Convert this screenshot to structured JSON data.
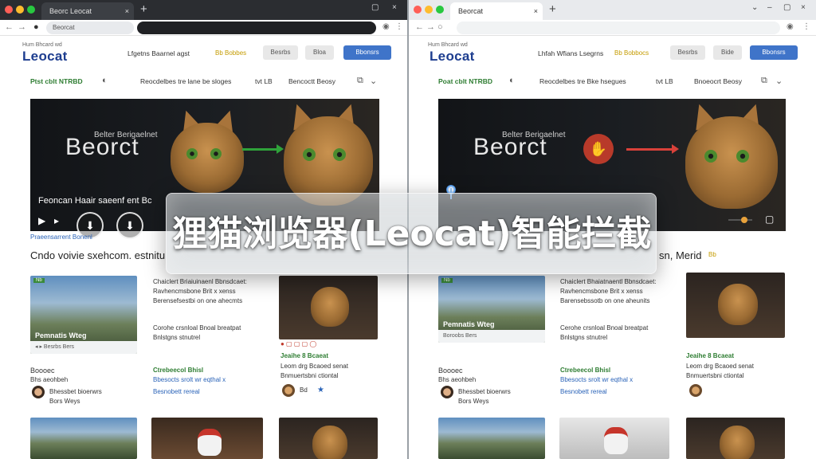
{
  "overlay": {
    "title": "狸猫浏览器(Leocat)智能拦截"
  },
  "left": {
    "tab_title": "Beorc Leocat",
    "url": "Beorcat",
    "logo_top": "Hum Bhcard wd",
    "logo": "Leocat",
    "nav_link": "Lfgetns Baarnel agst",
    "badge": "Bb Bobbes",
    "btn_grey1": "Besrbs",
    "btn_grey2": "Bloa",
    "btn_blue": "Bbonsrs",
    "subnav_green": "Ptst cblt  NTRBD",
    "subnav_links": [
      "Reocdelbes tre lane be sloges",
      "tvt LB",
      "Bencoctt Beosy"
    ],
    "hero_sub": "Belter Berigaelnet",
    "hero_title": "Beorct",
    "hero_caption": "Feoncan Haair saeenf ent Bc",
    "strip": "Praeensarrent Bonenl",
    "headline": "Cndo voivie sxehcom. estnitu",
    "card1_caption": "Pemnatis Wteg",
    "card1_bar": "◂  ▸ Besrbs Bers",
    "card2_lines": [
      "Chaiclert Briaiuinaenl Bbnsdcaet:",
      "Ravhencmsbone Brit x xenss",
      "Berensefsestbi on one ahecmts",
      "Corohe crsnloal Bnoal breatpat",
      "Bnlstgns stnutrel"
    ],
    "card3_title": "Jeaihe 8 Bcaeat",
    "card3_lines": [
      "Leom drg Bcaoed senat",
      "Bnmuertsbni ctiontal"
    ],
    "card3_author": "Bd",
    "row_a": [
      "Boooec",
      "Ctrebeecol Bhisl",
      "Bhs aeohbeh"
    ],
    "row_b": [
      "Bhessbet bioerwrs",
      "Bors Weys"
    ],
    "row_c": [
      "Bbesocts srolt wr eqthal x",
      "Besnobett rereal"
    ]
  },
  "right": {
    "tab_title": "Beorcat",
    "logo_top": "Hum Bhcard wd",
    "logo": "Leocat",
    "nav_link": "Lhfah Wfians Lsegrns",
    "badge": "Bb Bobbocs",
    "btn_grey1": "Besrbs",
    "btn_grey2": "Bide",
    "btn_blue": "Bbonsrs",
    "subnav_green": "Poat cblt  NTRBD",
    "subnav_links": [
      "Reocdelbes tre Bke hsegues",
      "tvt LB",
      "Bnoeocrt Beosy"
    ],
    "hero_sub": "Belter Berigaelnet",
    "hero_title": "Beorct",
    "headline_tail": "sn, Merid",
    "headline_badge": "Bb",
    "card1_caption": "Pemnatis Wteg",
    "card1_bar": "Boroobs Bers",
    "card2_lines": [
      "Chaiclert Bhaiatnaentl Bbnsdcaet:",
      "Ravhencmsbone Brit x xenss",
      "Barensebssotb on one aheunits",
      "Cerohe crsnloal Bnoal breatpat",
      "Bnlstgns stnutrel"
    ],
    "card3_title": "Jeaihe 8 Bcaeat",
    "card3_lines": [
      "Leom drg Bcaoed senat",
      "Bnmuertsbni ctiontal"
    ],
    "row_a": [
      "Boooec",
      "Ctrebeecol Bhisl",
      "Bhs aeohbeh"
    ],
    "row_b": [
      "Bhessbet bioerwrs",
      "Bors Weys"
    ],
    "row_c": [
      "Bbesocts srolt wr eqthal x",
      "Besnobett rereal"
    ]
  },
  "icons": {
    "close": "×",
    "newtab": "+",
    "back": "←",
    "forward": "→",
    "reload": "○",
    "play": "▶",
    "arrow_down": "⬇",
    "star": "★",
    "menu": "⋮",
    "download": "⬇",
    "minimize": "–",
    "maximize": "▢"
  },
  "colors": {
    "brand_blue": "#3f74c9",
    "block_red": "#b83a2a",
    "green_arrow": "#2fa23a",
    "red_arrow": "#d9413a"
  }
}
